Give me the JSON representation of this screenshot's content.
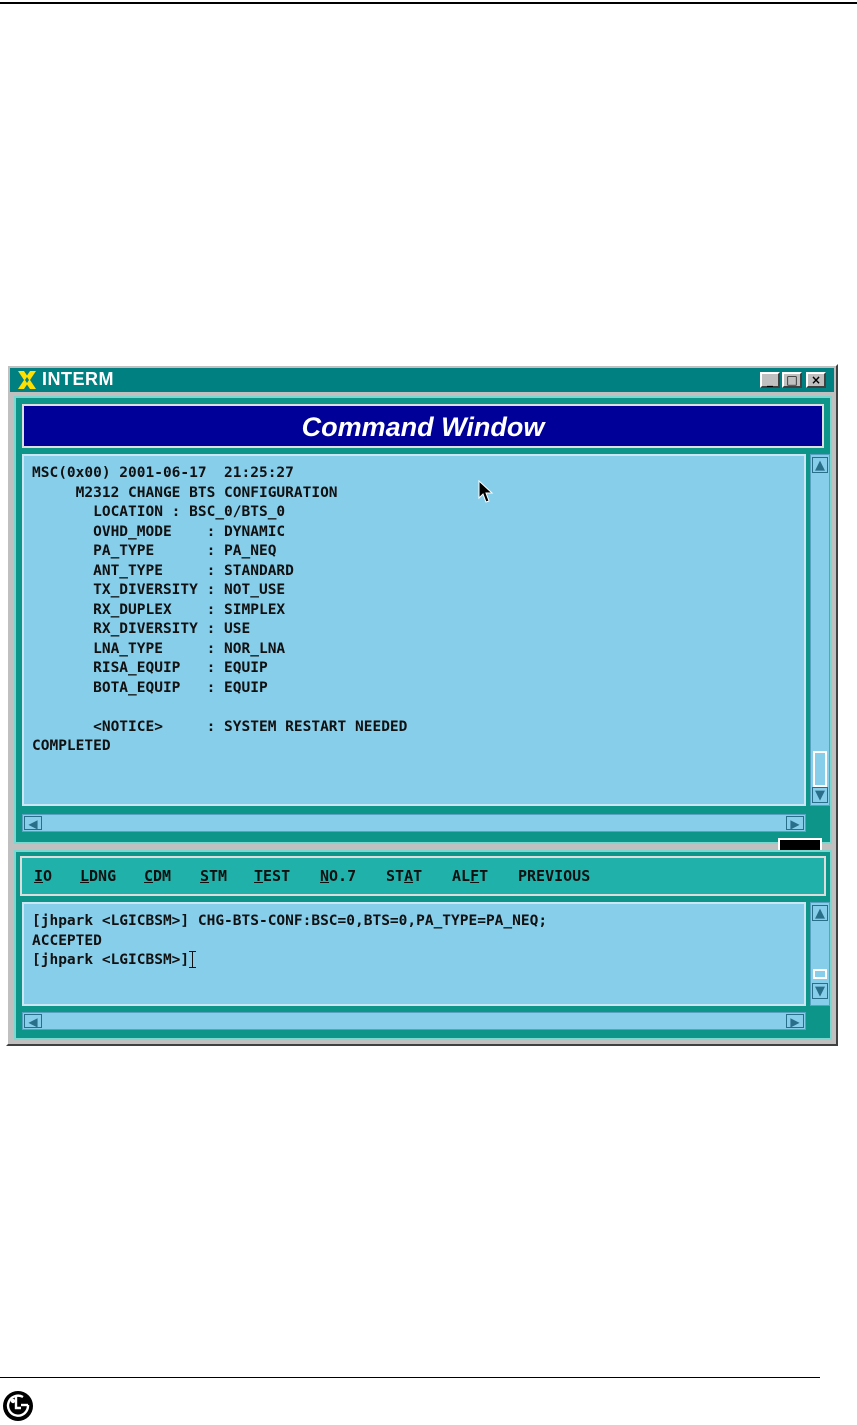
{
  "window": {
    "title": "INTERM",
    "buttons": {
      "minimize": "_",
      "maximize": "□",
      "close": "×"
    }
  },
  "command_window": {
    "title": "Command Window",
    "output_lines": [
      "MSC(0x00) 2001-06-17  21:25:27",
      "     M2312 CHANGE BTS CONFIGURATION",
      "       LOCATION : BSC_0/BTS_0",
      "       OVHD_MODE    : DYNAMIC",
      "       PA_TYPE      : PA_NEQ",
      "       ANT_TYPE     : STANDARD",
      "       TX_DIVERSITY : NOT_USE",
      "       RX_DUPLEX    : SIMPLEX",
      "       RX_DIVERSITY : USE",
      "       LNA_TYPE     : NOR_LNA",
      "       RISA_EQUIP   : EQUIP",
      "       BOTA_EQUIP   : EQUIP",
      "",
      "       <NOTICE>     : SYSTEM RESTART NEEDED",
      "COMPLETED"
    ]
  },
  "menu": [
    {
      "key": "I",
      "rest": "O"
    },
    {
      "key": "L",
      "rest": "DNG"
    },
    {
      "key": "C",
      "rest": "DM"
    },
    {
      "key": "S",
      "rest": "TM"
    },
    {
      "key": "T",
      "rest": "EST"
    },
    {
      "key": "N",
      "rest": "O.7"
    },
    {
      "pre": "ST",
      "key": "A",
      "rest": "T"
    },
    {
      "pre": "AL",
      "key": "F",
      "rest": "T"
    },
    {
      "pre": "PREVIOUS",
      "key": "",
      "rest": ""
    }
  ],
  "input": {
    "line1": "[jhpark <LGICBSM>] CHG-BTS-CONF:BSC=0,BTS=0,PA_TYPE=PA_NEQ;",
    "line2": "ACCEPTED",
    "prompt": "[jhpark <LGICBSM>]"
  },
  "icons": {
    "app": "x-logo-icon",
    "cursor": "mouse-pointer-icon",
    "footer_logo": "lg-logo-icon"
  },
  "colors": {
    "titlebar": "#008080",
    "header": "#000099",
    "terminal_bg": "#87ceeb",
    "panel": "#0d958a",
    "menubar": "#20b2aa"
  }
}
